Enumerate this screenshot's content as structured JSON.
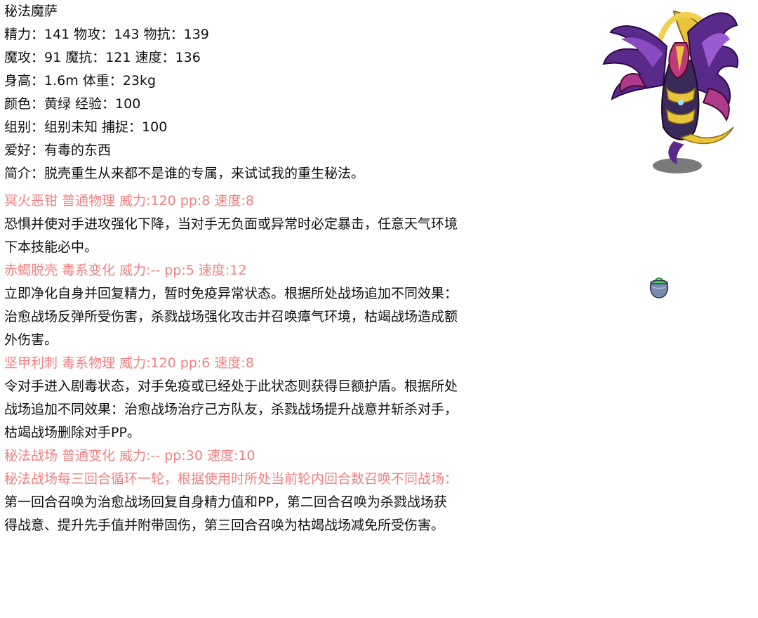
{
  "pet": {
    "name": "秘法魔萨",
    "stats_line1": "精力：141 物攻：143 物抗：139",
    "stats_line2": "魔攻：91 魔抗：121 速度：136",
    "body": "身高：1.6m 体重：23kg",
    "color_exp": "颜色：黄绿 经验：100",
    "group_catch": "组别：组别未知 捕捉：100",
    "hobby": "爱好：有毒的东西",
    "intro": "简介：脱壳重生从来都不是谁的专属，来试试我的重生秘法。"
  },
  "skills": [
    {
      "title": "冥火恶钳 普通物理 威力:120 pp:8 速度:8",
      "desc_lines": [
        "恐惧并使对手进攻强化下降，当对手无负面或异常时必定暴击，任意天气环境",
        "下本技能必中。"
      ]
    },
    {
      "title": "赤蝎脱壳 毒系变化 威力:-- pp:5 速度:12",
      "desc_lines": [
        "立即净化自身并回复精力，暂时免疫异常状态。根据所处战场追加不同效果：",
        "治愈战场反弹所受伤害，杀戮战场强化攻击并召唤瘴气环境，枯竭战场造成额",
        "外伤害。"
      ]
    },
    {
      "title": "坚甲利刺 毒系物理 威力:120 pp:6 速度:8",
      "desc_lines": [
        "令对手进入剧毒状态，对手免疫或已经处于此状态则获得巨额护盾。根据所处",
        "战场追加不同效果：治愈战场治疗己方队友，杀戮战场提升战意并斩杀对手，",
        "枯竭战场删除对手PP。"
      ]
    },
    {
      "title": "秘法战场 普通变化 威力:-- pp:30 速度:10",
      "desc_highlight": "秘法战场每三回合循环一轮，根据使用时所处当前轮内回合数召唤不同战场：",
      "desc_lines": [
        "第一回合召唤为治愈战场回复自身精力值和PP，第二回合召唤为杀戮战场获",
        "得战意、提升先手值并附带固伤，第三回合召唤为枯竭战场减免所受伤害。"
      ]
    }
  ],
  "colors": {
    "skill_title": "#f08080",
    "text": "#111111"
  },
  "icons": {
    "portrait": "winged-pharaoh-creature",
    "item": "potion-pot-icon"
  }
}
